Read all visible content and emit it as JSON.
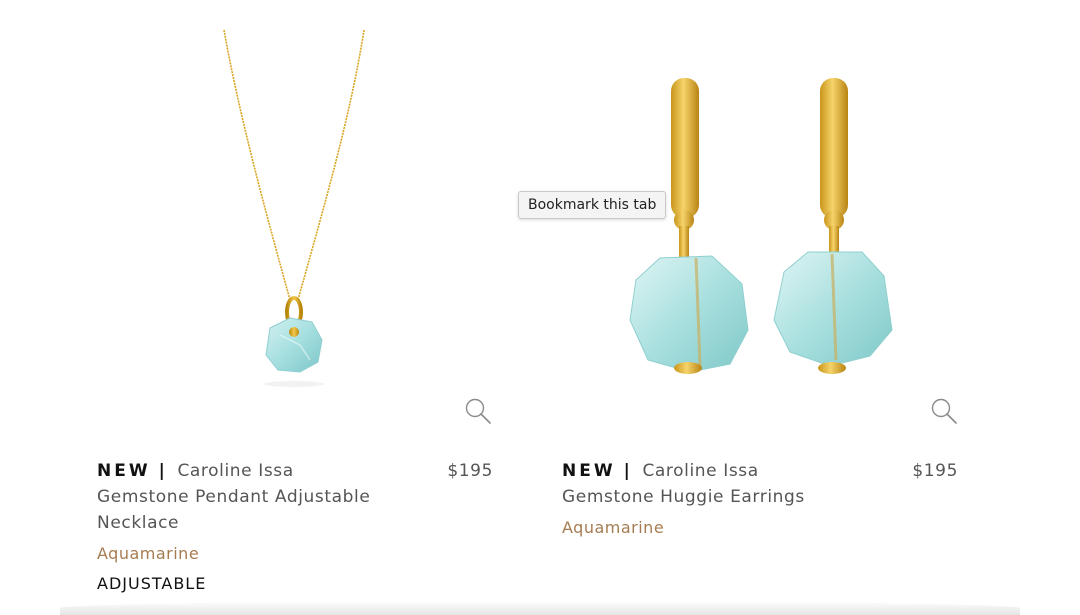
{
  "tooltip": {
    "text": "Bookmark this tab"
  },
  "products": [
    {
      "new_label": "NEW",
      "separator": "|",
      "brand": "Caroline Issa",
      "name": "Gemstone Pendant Adjustable Necklace",
      "price": "$195",
      "color": "Aquamarine",
      "size": "ADJUSTABLE",
      "zoom_icon": "magnifier-icon"
    },
    {
      "new_label": "NEW",
      "separator": "|",
      "brand": "Caroline Issa",
      "name": "Gemstone Huggie Earrings",
      "price": "$195",
      "color": "Aquamarine",
      "zoom_icon": "magnifier-icon"
    }
  ],
  "colors": {
    "accent_color": "#a67c52",
    "gold": "#d9a520",
    "aquamarine": "#a6dfe0"
  }
}
